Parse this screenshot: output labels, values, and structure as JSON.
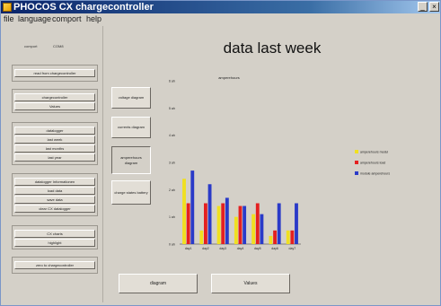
{
  "window": {
    "title": "PHOCOS CX chargecontroller"
  },
  "menu": [
    "file",
    "language",
    "comport",
    "help"
  ],
  "sidebar": {
    "comport_label": "comport",
    "comport_value": "COM8",
    "read_button": "read from chargecontroller",
    "group2": [
      "chargecontroller",
      "Values"
    ],
    "group3": [
      "datalogger",
      "last week",
      "last months",
      "last year"
    ],
    "group4": [
      "datalogger Informationen",
      "load data",
      "save data",
      "clear CX datalogger"
    ],
    "group5": [
      "CX charts",
      "highlight"
    ],
    "write_button": "zero to chargecontroller"
  },
  "main": {
    "title": "data last week",
    "side_buttons": [
      {
        "label": "voltage diagram"
      },
      {
        "label": "currents diagram"
      },
      {
        "label": "amperehours diagram",
        "active": true
      },
      {
        "label": "charge states battery"
      }
    ],
    "bottom_buttons": [
      "diagram",
      "Values"
    ]
  },
  "chart_data": {
    "type": "bar",
    "title": "amperehours",
    "categories": [
      "day1",
      "day2",
      "day3",
      "day4",
      "day5",
      "day6",
      "day7"
    ],
    "y_ticks": [
      "0 ah",
      "1 ah",
      "2 ah",
      "3 ah",
      "4 ah",
      "5 ah",
      "6 ah"
    ],
    "ylim": [
      0,
      6
    ],
    "series": [
      {
        "name": "amperehours modul",
        "color": "#f0e020",
        "values": [
          2.4,
          0.5,
          1.4,
          1.0,
          1.1,
          0.3,
          0.5
        ]
      },
      {
        "name": "amperehours load",
        "color": "#e42020",
        "values": [
          1.5,
          1.5,
          1.5,
          1.4,
          1.5,
          0.5,
          0.5
        ]
      },
      {
        "name": "module amperehours",
        "color": "#2a3ac8",
        "values": [
          2.7,
          2.2,
          1.7,
          1.4,
          1.1,
          1.5,
          1.5
        ]
      }
    ],
    "legend_position": "right"
  }
}
